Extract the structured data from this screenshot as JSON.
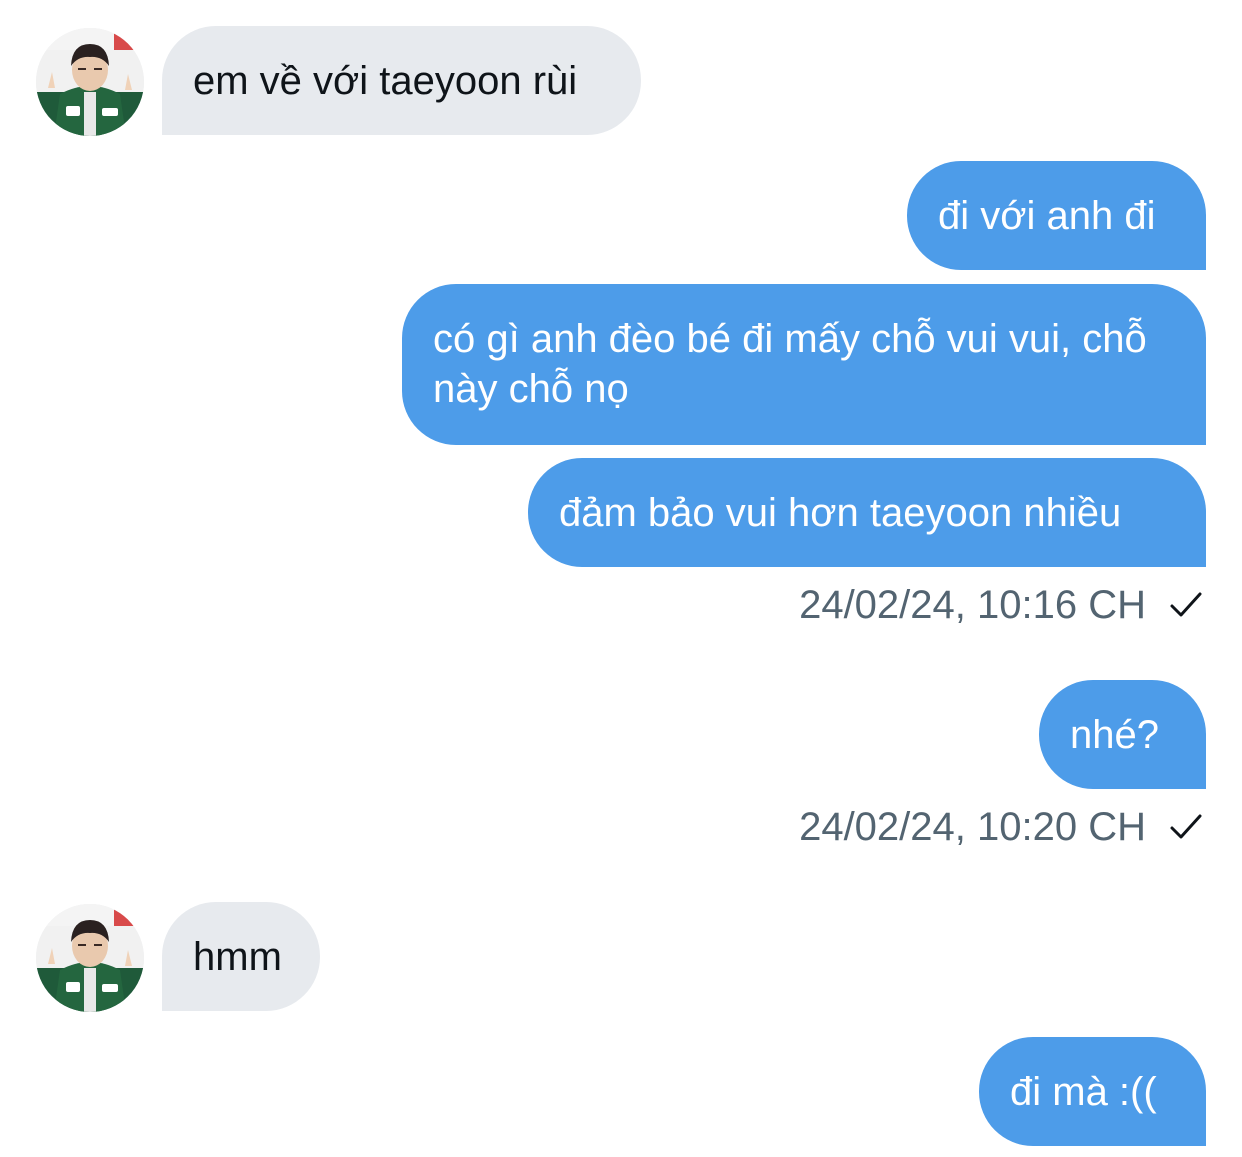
{
  "conversation": {
    "messages": [
      {
        "from": "them",
        "text": "em về với taeyoon rùi"
      },
      {
        "from": "me",
        "text": "đi với anh đi"
      },
      {
        "from": "me",
        "text": "có gì anh đèo bé đi mấy chỗ vui vui, chỗ này chỗ nọ"
      },
      {
        "from": "me",
        "text": "đảm bảo vui hơn taeyoon nhiều"
      },
      {
        "from": "me",
        "text": "nhé?"
      },
      {
        "from": "them",
        "text": "hmm"
      },
      {
        "from": "me",
        "text": "đi mà :(("
      }
    ],
    "timestamps": [
      {
        "text": "24/02/24, 10:16 CH",
        "status_icon": "checkmark-icon"
      },
      {
        "text": "24/02/24, 10:20 CH",
        "status_icon": "checkmark-icon"
      }
    ]
  },
  "avatar": {
    "jacket_color": "#1f5a3a",
    "background_accent": "#d84a4a"
  },
  "colors": {
    "incoming_bubble": "#e7eaee",
    "outgoing_bubble": "#4d9ce9",
    "timestamp_text": "#536471"
  }
}
